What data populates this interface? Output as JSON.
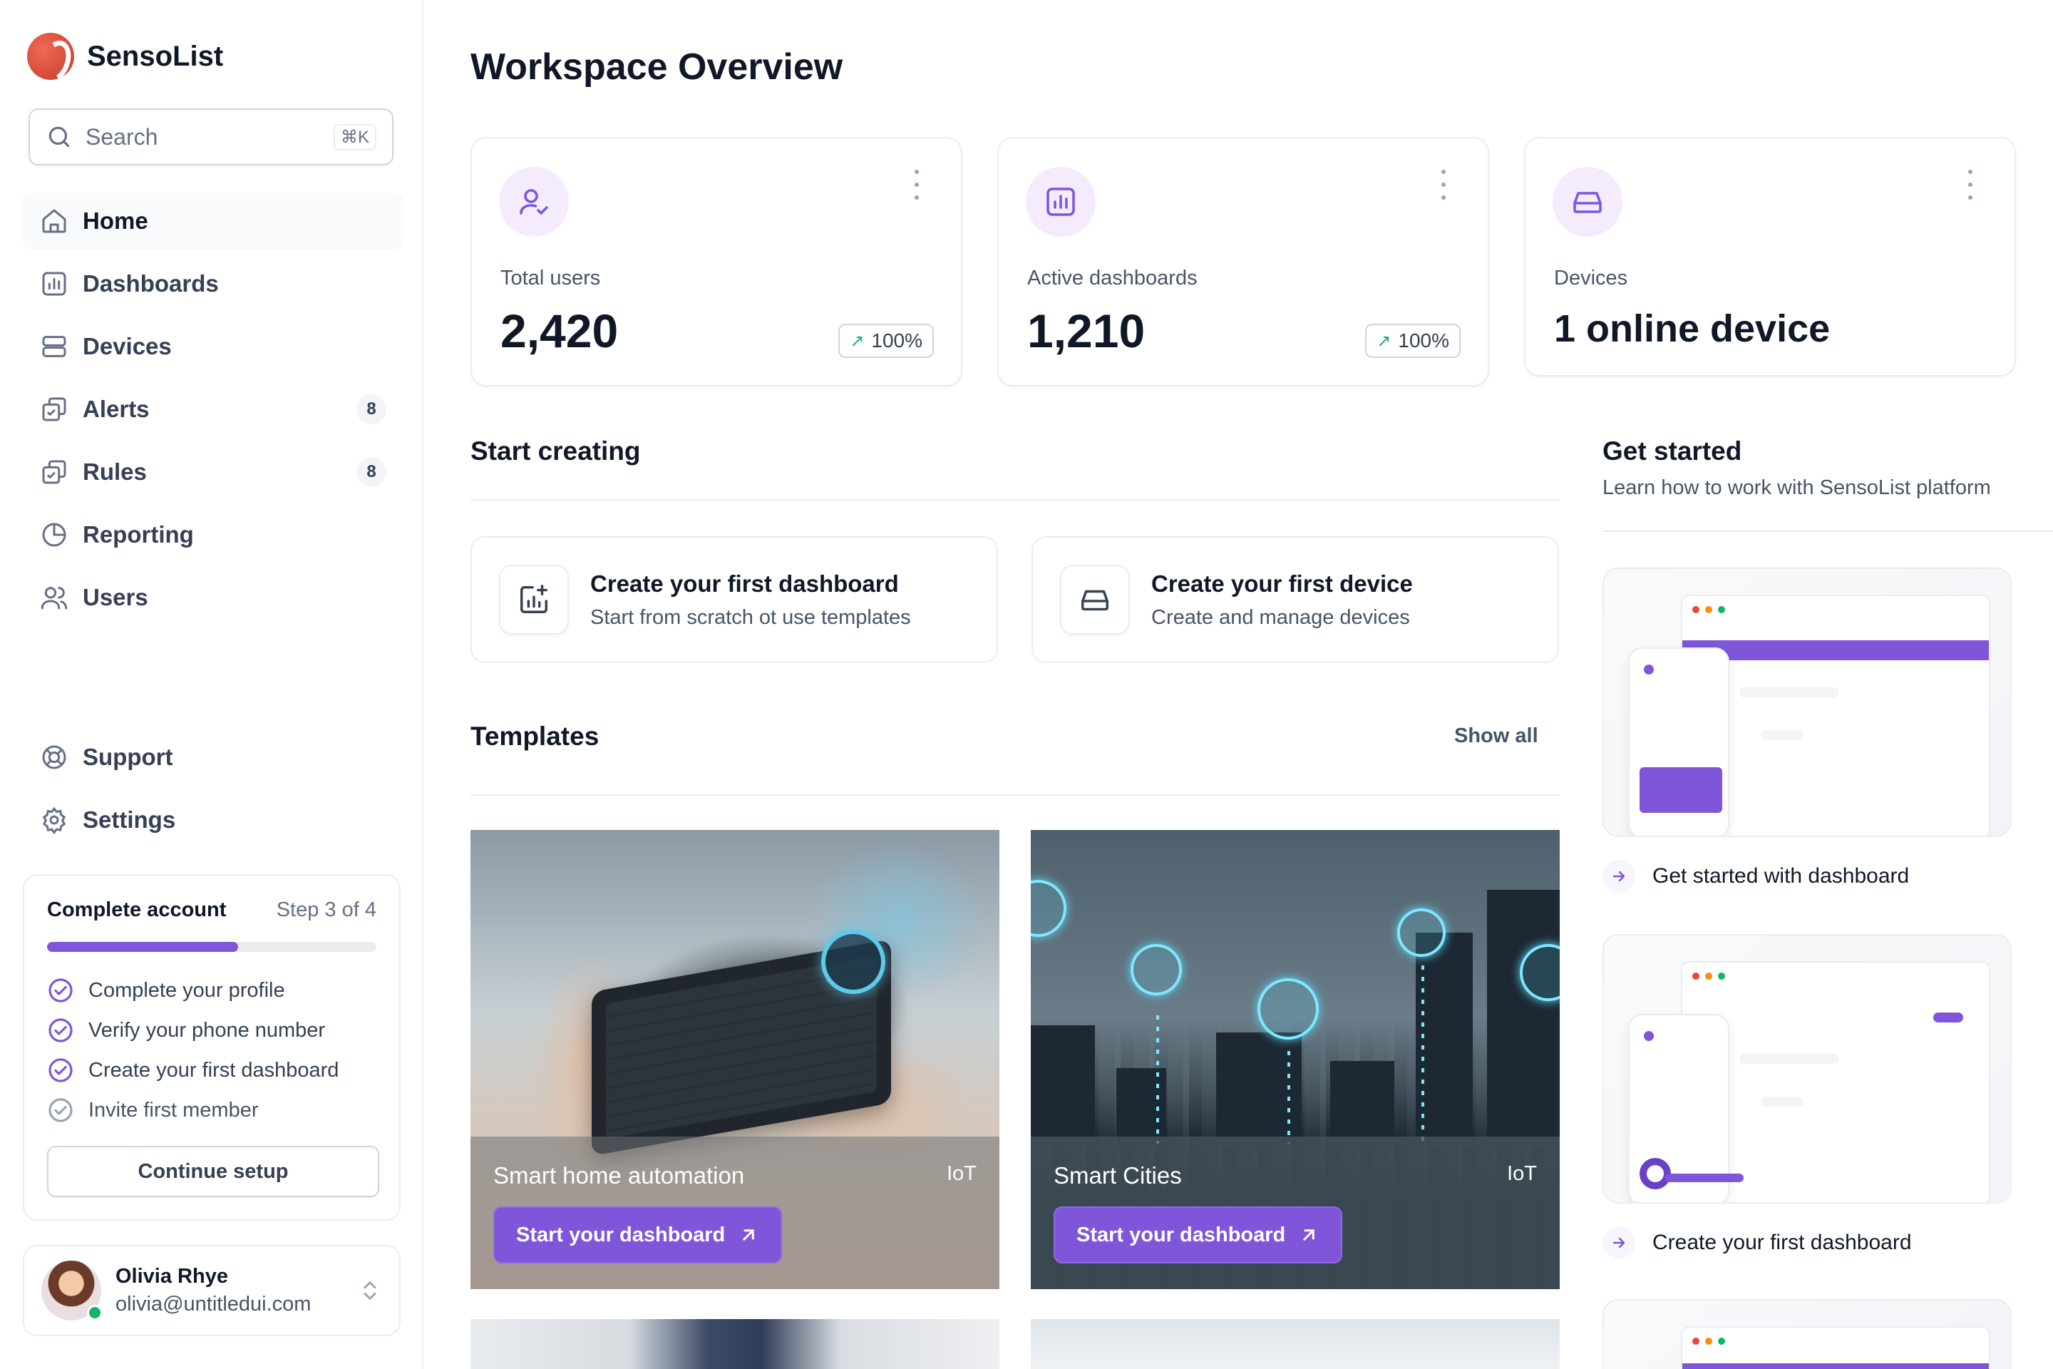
{
  "app": {
    "name": "SensoList"
  },
  "search": {
    "placeholder": "Search",
    "shortcut": "⌘K"
  },
  "sidebar": {
    "items": [
      {
        "label": "Home",
        "icon": "home-icon",
        "active": true
      },
      {
        "label": "Dashboards",
        "icon": "bar-chart-icon"
      },
      {
        "label": "Devices",
        "icon": "server-icon"
      },
      {
        "label": "Alerts",
        "icon": "alert-copy-icon",
        "badge": "8"
      },
      {
        "label": "Rules",
        "icon": "rules-copy-icon",
        "badge": "8"
      },
      {
        "label": "Reporting",
        "icon": "pie-chart-icon"
      },
      {
        "label": "Users",
        "icon": "users-icon"
      }
    ],
    "bottom_items": [
      {
        "label": "Support",
        "icon": "life-buoy-icon"
      },
      {
        "label": "Settings",
        "icon": "gear-icon"
      }
    ]
  },
  "account": {
    "title": "Complete account",
    "step": "Step 3 of 4",
    "progress": 0.58,
    "tasks": [
      {
        "label": "Complete your profile",
        "done": true
      },
      {
        "label": "Verify your phone number",
        "done": true
      },
      {
        "label": "Create your first dashboard",
        "done": true
      },
      {
        "label": "Invite first member",
        "done": false
      }
    ],
    "cta": "Continue setup"
  },
  "user": {
    "name": "Olivia Rhye",
    "email": "olivia@untitledui.com",
    "status": "online"
  },
  "page": {
    "title": "Workspace Overview"
  },
  "stats": [
    {
      "icon": "user-check-icon",
      "label": "Total users",
      "value": "2,420",
      "trend": "100%"
    },
    {
      "icon": "bar-chart-icon",
      "label": "Active dashboards",
      "value": "1,210",
      "trend": "100%"
    },
    {
      "icon": "hard-drive-icon",
      "label": "Devices",
      "value": "1 online device"
    }
  ],
  "start_creating": {
    "title": "Start creating",
    "cards": [
      {
        "title": "Create your first dashboard",
        "subtitle": "Start from scratch ot use templates",
        "icon": "dashboard-add-icon"
      },
      {
        "title": "Create your first device",
        "subtitle": "Create and manage devices",
        "icon": "hard-drive-icon"
      }
    ]
  },
  "templates": {
    "title": "Templates",
    "show_all": "Show all",
    "items": [
      {
        "name": "Smart home automation",
        "tag": "IoT",
        "cta": "Start your dashboard"
      },
      {
        "name": "Smart Cities",
        "tag": "IoT",
        "cta": "Start your dashboard"
      }
    ]
  },
  "get_started": {
    "title": "Get started",
    "subtitle": "Learn how to work with SensoList platform",
    "links": [
      {
        "label": "Get started with dashboard"
      },
      {
        "label": "Create your first dashboard"
      }
    ]
  },
  "colors": {
    "brand": "#7f56d9",
    "brand_light": "#f4ebff",
    "success": "#17b26a",
    "text_primary": "#101828",
    "text_secondary": "#475467",
    "border": "#eaecf0"
  }
}
